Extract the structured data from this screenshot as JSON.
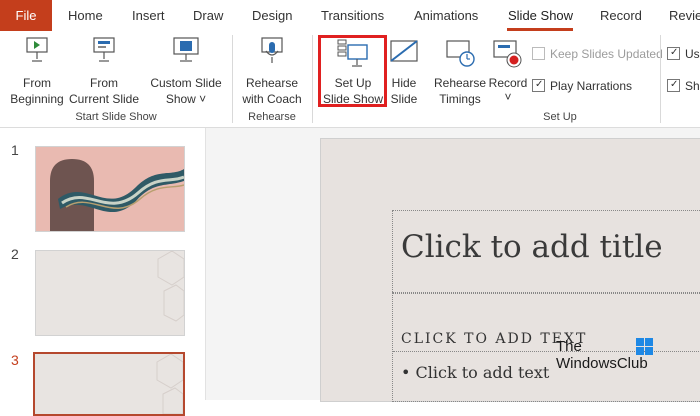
{
  "tabs": {
    "file": "File",
    "home": "Home",
    "insert": "Insert",
    "draw": "Draw",
    "design": "Design",
    "transitions": "Transitions",
    "animations": "Animations",
    "slideshow": "Slide Show",
    "record": "Record",
    "review": "Revie"
  },
  "ribbon": {
    "from_beginning": [
      "From",
      "Beginning"
    ],
    "from_current": [
      "From",
      "Current Slide"
    ],
    "custom_show": [
      "Custom Slide",
      "Show ˅"
    ],
    "group_start": "Start Slide Show",
    "rehearse_coach": [
      "Rehearse",
      "with Coach"
    ],
    "group_rehearse": "Rehearse",
    "setup": [
      "Set Up",
      "Slide Show"
    ],
    "hide": [
      "Hide",
      "Slide"
    ],
    "rehearse_timings": [
      "Rehearse",
      "Timings"
    ],
    "record": [
      "Record",
      "˅"
    ],
    "keep_updated": "Keep Slides Updated",
    "play_narrations": "Play Narrations",
    "use_timings": "Us",
    "show_media": "Sh",
    "group_setup": "Set Up"
  },
  "thumbnails": {
    "numbers": [
      "1",
      "2",
      "3"
    ]
  },
  "slide": {
    "title_placeholder": "Click to add title",
    "subtitle_caps": "CLICK TO ADD TEXT",
    "bullet_text": "•  Click to add text"
  },
  "watermark": {
    "line1": "The",
    "line2": "WindowsClub"
  },
  "colors": {
    "accent": "#c43e1c",
    "highlight": "#e02020"
  },
  "icons": {
    "from_beginning": "slideshow-play-icon",
    "from_current": "slideshow-current-icon",
    "custom_show": "custom-show-icon",
    "rehearse_coach": "microphone-coach-icon",
    "setup": "setup-slideshow-icon",
    "hide": "hide-slide-icon",
    "rehearse_timings": "timer-icon",
    "record": "record-icon"
  }
}
